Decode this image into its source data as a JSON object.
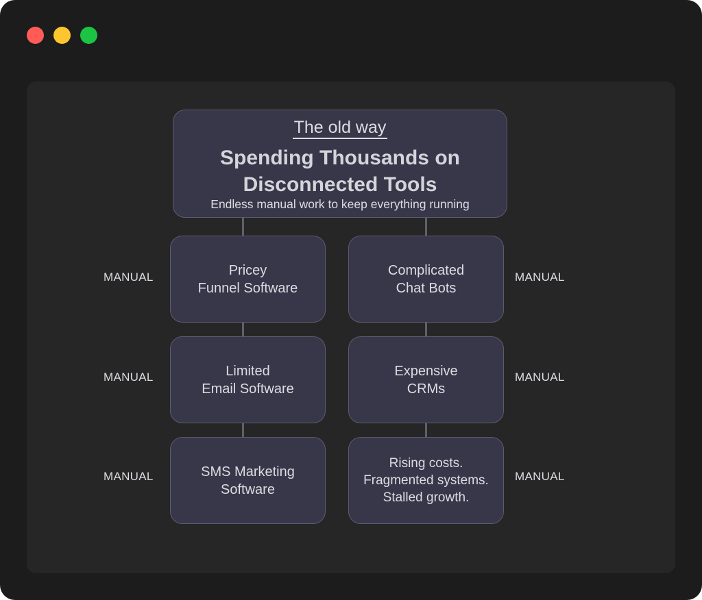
{
  "window": {
    "traffic_lights": {
      "close_color": "#ff5c57",
      "minimize_color": "#fec62e",
      "maximize_color": "#1bc443"
    }
  },
  "header": {
    "eyebrow": "The old way",
    "headline": "Spending Thousands on\nDisconnected Tools",
    "subline": "Endless manual work to keep everything running"
  },
  "left_column": [
    {
      "label": "Pricey\nFunnel Software",
      "tag": "MANUAL"
    },
    {
      "label": "Limited\nEmail Software",
      "tag": "MANUAL"
    },
    {
      "label": "SMS Marketing\nSoftware",
      "tag": "MANUAL"
    }
  ],
  "right_column": [
    {
      "label": "Complicated\nChat Bots",
      "tag": "MANUAL"
    },
    {
      "label": "Expensive\nCRMs",
      "tag": "MANUAL"
    },
    {
      "label": "Rising costs.\nFragmented systems.\nStalled growth.",
      "tag": "MANUAL"
    }
  ],
  "colors": {
    "window_bg": "#1c1c1c",
    "panel_bg": "#262626",
    "box_bg": "#38374a",
    "box_border": "#5c5b6e",
    "text": "#dcdce2",
    "connector": "#5f6068"
  }
}
